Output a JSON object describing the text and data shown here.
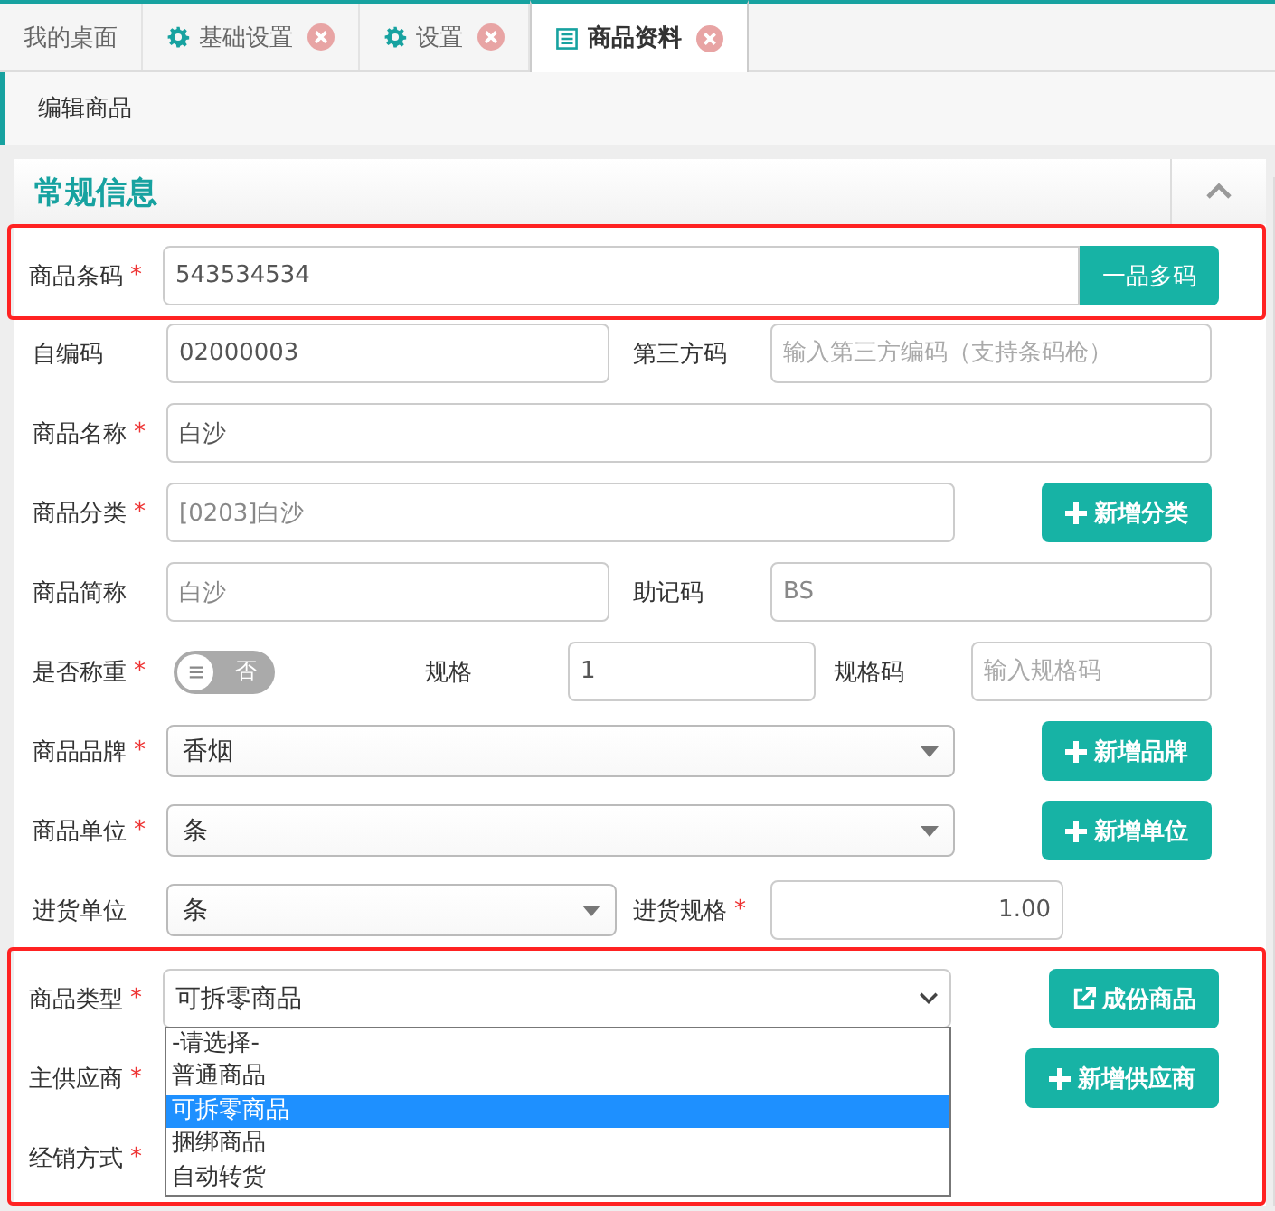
{
  "tabs": [
    {
      "label": "我的桌面",
      "kind": "home",
      "closable": false,
      "selected": false
    },
    {
      "label": "基础设置",
      "kind": "settings",
      "closable": true,
      "selected": false
    },
    {
      "label": "设置",
      "kind": "settings",
      "closable": true,
      "selected": false
    },
    {
      "label": "商品资料",
      "kind": "page",
      "closable": true,
      "selected": true
    }
  ],
  "breadcrumb": "编辑商品",
  "section": {
    "title": "常规信息",
    "expanded": true
  },
  "groups": [
    {
      "highlighted": true,
      "rows": [
        {
          "kind": "addon",
          "fields": [
            {
              "label": "商品条码",
              "required_mark": "*",
              "kind": "input",
              "value": "543534534"
            }
          ],
          "button": {
            "label": "一品多码",
            "kind": "addon"
          }
        }
      ]
    },
    {
      "rows": [
        {
          "kind": "pair",
          "fields": [
            {
              "label": "自编码",
              "kind": "input",
              "value": "02000003"
            },
            {
              "label": "第三方码",
              "kind": "input",
              "placeholder": "输入第三方编码（支持条码枪）"
            }
          ]
        },
        {
          "kind": "single",
          "fields": [
            {
              "label": "商品名称",
              "required_mark": "*",
              "kind": "input",
              "value": "白沙"
            }
          ]
        },
        {
          "kind": "with-button",
          "fields": [
            {
              "label": "商品分类",
              "required_mark": "*",
              "kind": "readonly",
              "value": "[0203]白沙"
            }
          ],
          "button": {
            "label": "新增分类",
            "kind": "add"
          }
        },
        {
          "kind": "pair",
          "fields": [
            {
              "label": "商品简称",
              "kind": "readonly",
              "value": "白沙"
            },
            {
              "label": "助记码",
              "kind": "readonly",
              "value": "BS"
            }
          ]
        },
        {
          "kind": "triple",
          "fields": [
            {
              "label": "是否称重",
              "required_mark": "*",
              "kind": "toggle",
              "on": false,
              "value": "否"
            },
            {
              "label": "规格",
              "kind": "input",
              "value": "1"
            },
            {
              "label": "规格码",
              "kind": "input",
              "placeholder": "输入规格码"
            }
          ]
        },
        {
          "kind": "with-button",
          "fields": [
            {
              "label": "商品品牌",
              "required_mark": "*",
              "kind": "select",
              "value": "香烟"
            }
          ],
          "button": {
            "label": "新增品牌",
            "kind": "add"
          }
        },
        {
          "kind": "with-button",
          "fields": [
            {
              "label": "商品单位",
              "required_mark": "*",
              "kind": "select",
              "value": "条"
            }
          ],
          "button": {
            "label": "新增单位",
            "kind": "add"
          }
        },
        {
          "kind": "pair-short",
          "fields": [
            {
              "label": "进货单位",
              "kind": "select",
              "value": "条"
            },
            {
              "label": "进货规格",
              "required_mark": "*",
              "kind": "number",
              "value": "1.00"
            }
          ]
        }
      ]
    },
    {
      "highlighted": true,
      "rows": [
        {
          "kind": "with-button",
          "fields": [
            {
              "label": "商品类型",
              "required_mark": "*",
              "kind": "native-select",
              "value": "可拆零商品",
              "expanded": true,
              "options": [
                {
                  "label": "-请选择-",
                  "selected": false
                },
                {
                  "label": "普通商品",
                  "selected": false
                },
                {
                  "label": "可拆零商品",
                  "selected": true
                },
                {
                  "label": "捆绑商品",
                  "selected": false
                },
                {
                  "label": "自动转货",
                  "selected": false
                }
              ]
            }
          ],
          "button": {
            "label": "成份商品",
            "kind": "link"
          }
        },
        {
          "kind": "with-button-wide",
          "fields": [
            {
              "label": "主供应商",
              "required_mark": "*",
              "kind": "hidden"
            }
          ],
          "button": {
            "label": "新增供应商",
            "kind": "add"
          }
        },
        {
          "kind": "single",
          "fields": [
            {
              "label": "经销方式",
              "required_mark": "*",
              "kind": "hidden"
            }
          ]
        }
      ]
    }
  ]
}
